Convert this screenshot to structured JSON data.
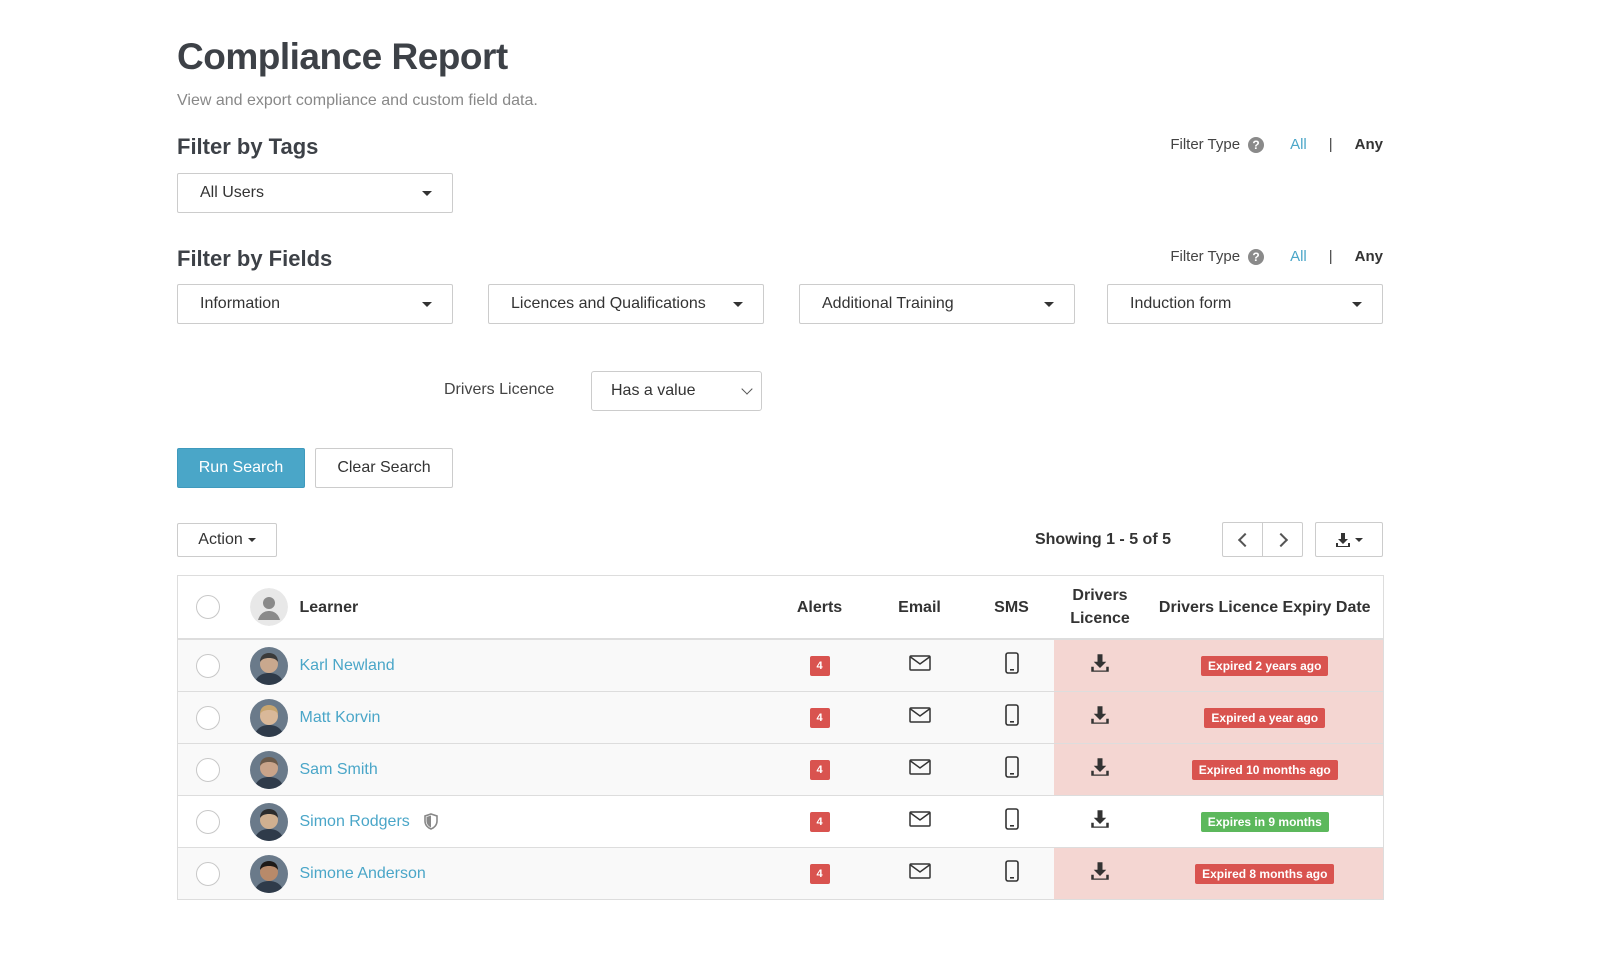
{
  "page": {
    "title": "Compliance Report",
    "subtitle": "View and export compliance and custom field data."
  },
  "filter_tags": {
    "title": "Filter by Tags",
    "filter_type_label": "Filter Type",
    "opt_all": "All",
    "separator": "|",
    "opt_any": "Any",
    "dropdown": "All Users"
  },
  "filter_fields": {
    "title": "Filter by Fields",
    "filter_type_label": "Filter Type",
    "opt_all": "All",
    "separator": "|",
    "opt_any": "Any",
    "dropdowns": [
      "Information",
      "Licences and Qualifications",
      "Additional Training",
      "Induction form"
    ]
  },
  "field_condition": {
    "label": "Drivers Licence",
    "value": "Has a value"
  },
  "buttons": {
    "run_search": "Run Search",
    "clear_search": "Clear Search",
    "action": "Action"
  },
  "pagination": {
    "showing": "Showing 1 - 5 of 5"
  },
  "table": {
    "headers": {
      "learner": "Learner",
      "alerts": "Alerts",
      "email": "Email",
      "sms": "SMS",
      "drivers_licence_l1": "Drivers",
      "drivers_licence_l2": "Licence",
      "expiry": "Drivers Licence Expiry Date"
    },
    "rows": [
      {
        "name": "Karl Newland",
        "alerts": "4",
        "expiry": "Expired 2 years ago",
        "status": "expired"
      },
      {
        "name": "Matt Korvin",
        "alerts": "4",
        "expiry": "Expired a year ago",
        "status": "expired"
      },
      {
        "name": "Sam Smith",
        "alerts": "4",
        "expiry": "Expired 10 months ago",
        "status": "expired"
      },
      {
        "name": "Simon Rodgers",
        "alerts": "4",
        "expiry": "Expires in 9 months",
        "status": "valid"
      },
      {
        "name": "Simone Anderson",
        "alerts": "4",
        "expiry": "Expired 8 months ago",
        "status": "expired"
      }
    ]
  },
  "colors": {
    "accent": "#4aa6c8",
    "expired_badge": "#d9534f",
    "valid_badge": "#5cb85c",
    "expired_cell": "#f4d6d2",
    "alert_badge": "#d9534f"
  },
  "icons": {
    "help": "question-circle-icon",
    "email": "envelope-icon",
    "sms": "mobile-phone-icon",
    "download": "download-icon",
    "shield": "shield-icon",
    "avatar_placeholder": "user-silhouette-icon"
  }
}
